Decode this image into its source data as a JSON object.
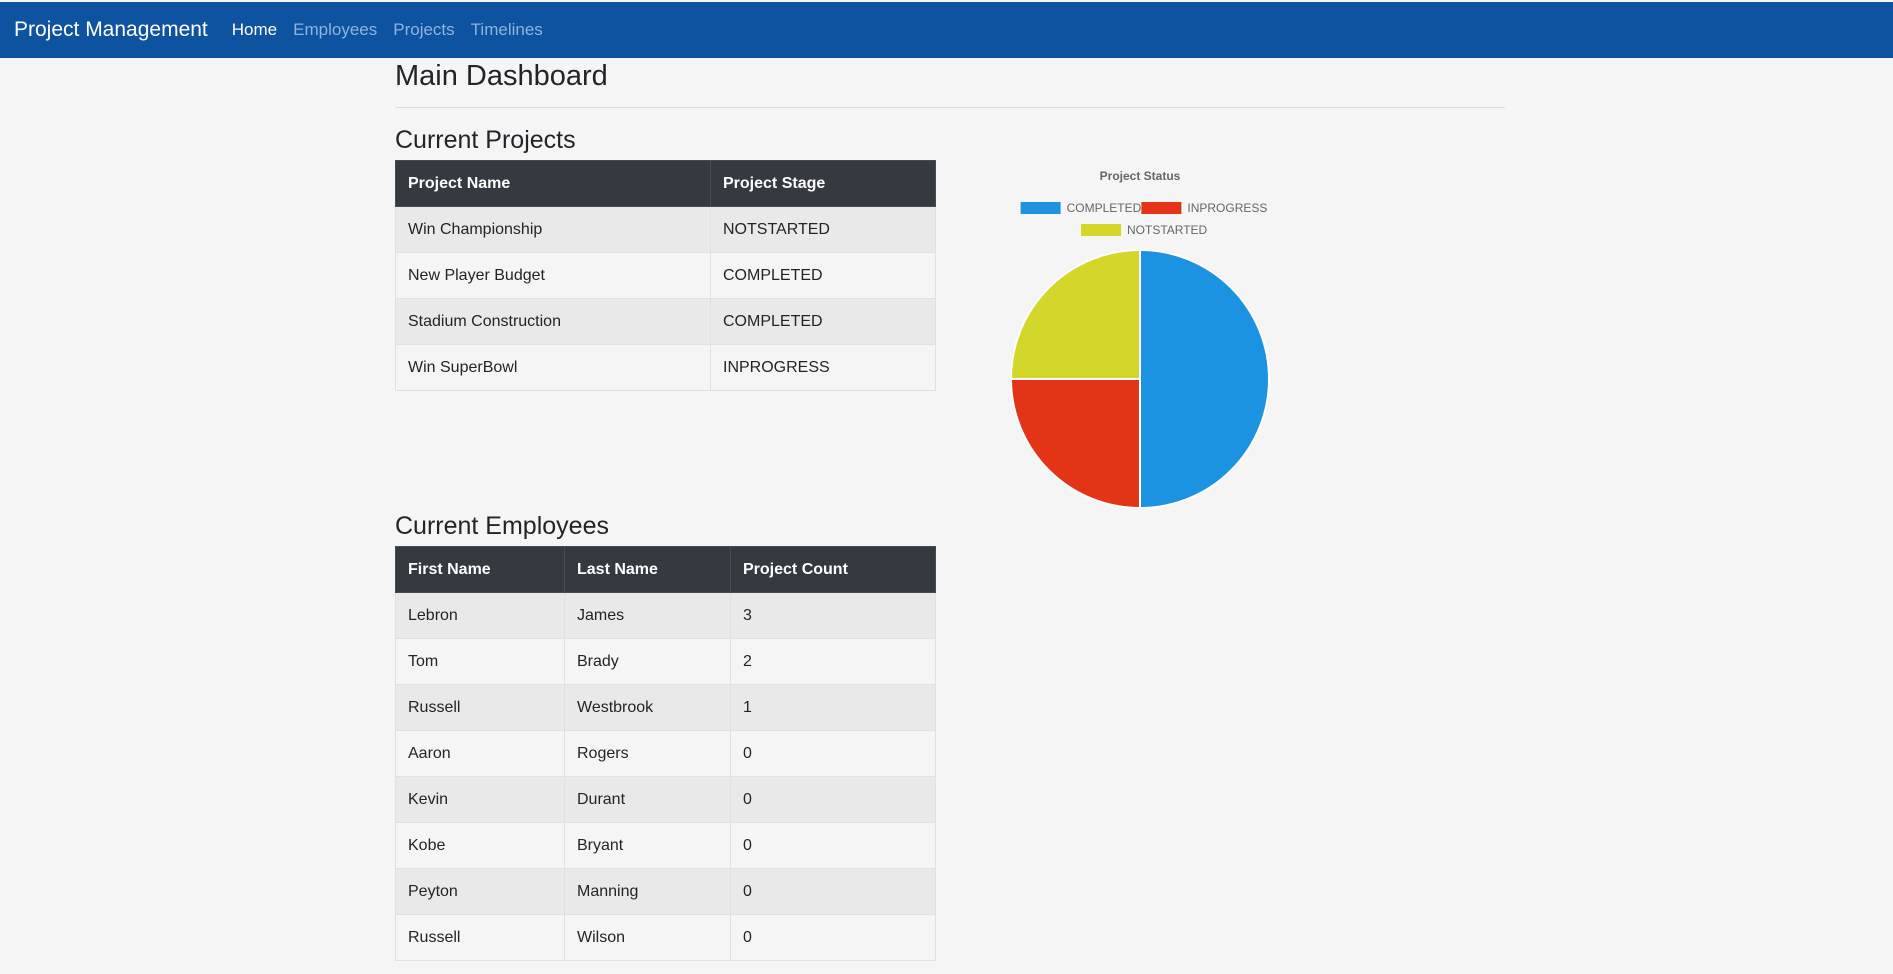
{
  "navbar": {
    "brand": "Project Management",
    "links": [
      {
        "label": "Home",
        "active": true
      },
      {
        "label": "Employees",
        "active": false
      },
      {
        "label": "Projects",
        "active": false
      },
      {
        "label": "Timelines",
        "active": false
      }
    ]
  },
  "page": {
    "title": "Main Dashboard"
  },
  "projects": {
    "heading": "Current Projects",
    "columns": [
      "Project Name",
      "Project Stage"
    ],
    "rows": [
      [
        "Win Championship",
        "NOTSTARTED"
      ],
      [
        "New Player Budget",
        "COMPLETED"
      ],
      [
        "Stadium Construction",
        "COMPLETED"
      ],
      [
        "Win SuperBowl",
        "INPROGRESS"
      ]
    ]
  },
  "employees": {
    "heading": "Current Employees",
    "columns": [
      "First Name",
      "Last Name",
      "Project Count"
    ],
    "rows": [
      [
        "Lebron",
        "James",
        "3"
      ],
      [
        "Tom",
        "Brady",
        "2"
      ],
      [
        "Russell",
        "Westbrook",
        "1"
      ],
      [
        "Aaron",
        "Rogers",
        "0"
      ],
      [
        "Kevin",
        "Durant",
        "0"
      ],
      [
        "Kobe",
        "Bryant",
        "0"
      ],
      [
        "Peyton",
        "Manning",
        "0"
      ],
      [
        "Russell",
        "Wilson",
        "0"
      ]
    ]
  },
  "chart_data": {
    "type": "pie",
    "title": "Project Status",
    "categories": [
      "COMPLETED",
      "INPROGRESS",
      "NOTSTARTED"
    ],
    "values": [
      2,
      1,
      1
    ],
    "colors": [
      "#1b93e0",
      "#e43418",
      "#d4d629"
    ],
    "legend_position": "top"
  }
}
